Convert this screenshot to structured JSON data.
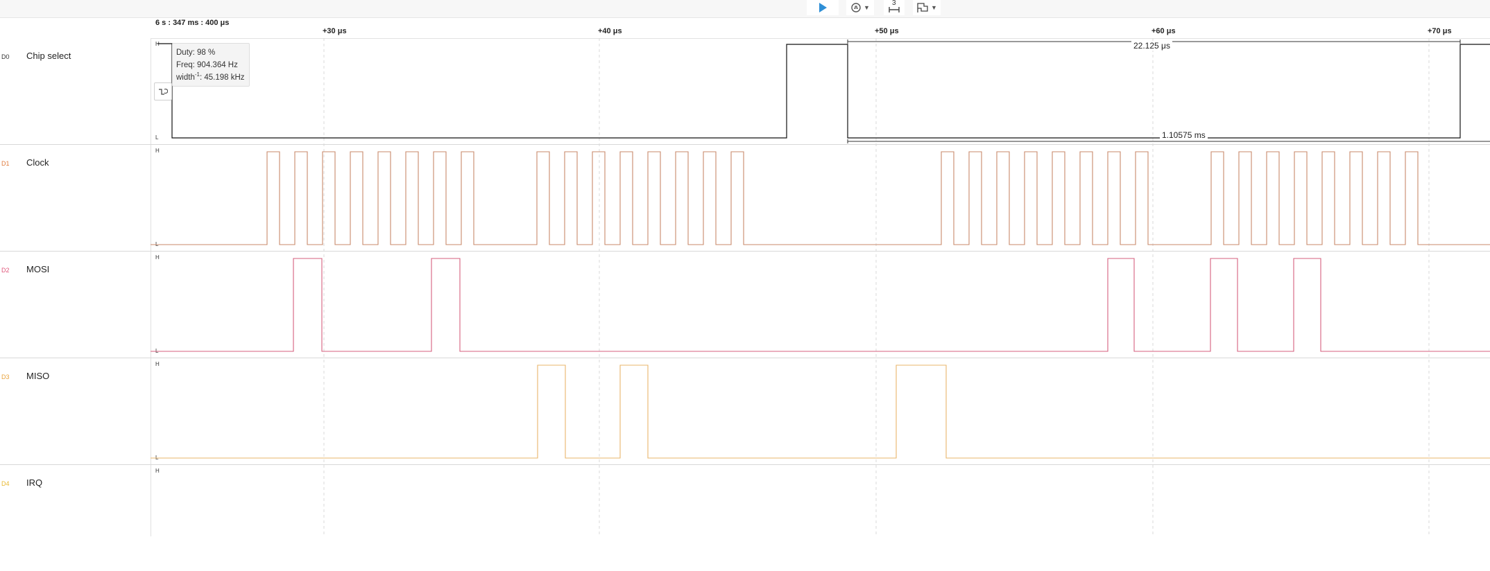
{
  "toolbar": {
    "run_icon": "play-icon",
    "trigger_icon": "trigger-settings-icon",
    "measure_icon": "measure-icon",
    "measure_badge": "3",
    "marker_icon": "marker-flag-icon"
  },
  "timebar": {
    "origin": "6 s : 347 ms : 400 μs",
    "ticks": [
      "+30 μs",
      "+40 μs",
      "+50 μs",
      "+60 μs",
      "+70 μs"
    ]
  },
  "channels": [
    {
      "id": "D0",
      "name": "Chip select",
      "color": "#111111",
      "id_color": "#333333"
    },
    {
      "id": "D1",
      "name": "Clock",
      "color": "#c8896a",
      "id_color": "#e07a3c"
    },
    {
      "id": "D2",
      "name": "MOSI",
      "color": "#d45f7e",
      "id_color": "#e0557a"
    },
    {
      "id": "D3",
      "name": "MISO",
      "color": "#e9b56a",
      "id_color": "#e9a23b"
    },
    {
      "id": "D4",
      "name": "IRQ",
      "color": "#e8c640",
      "id_color": "#e8b830"
    }
  ],
  "level_labels": {
    "high": "H",
    "low": "L"
  },
  "tooltip": {
    "duty": "Duty: 98 %",
    "freq": "Freq: 904.364 Hz",
    "width_prefix": "width",
    "width_sup": "-1",
    "width_value": ": 45.198 kHz"
  },
  "measurements": {
    "width": "22.125 μs",
    "period": "1.10575 ms"
  },
  "edge_button_icon": "edge-trigger-icon"
}
